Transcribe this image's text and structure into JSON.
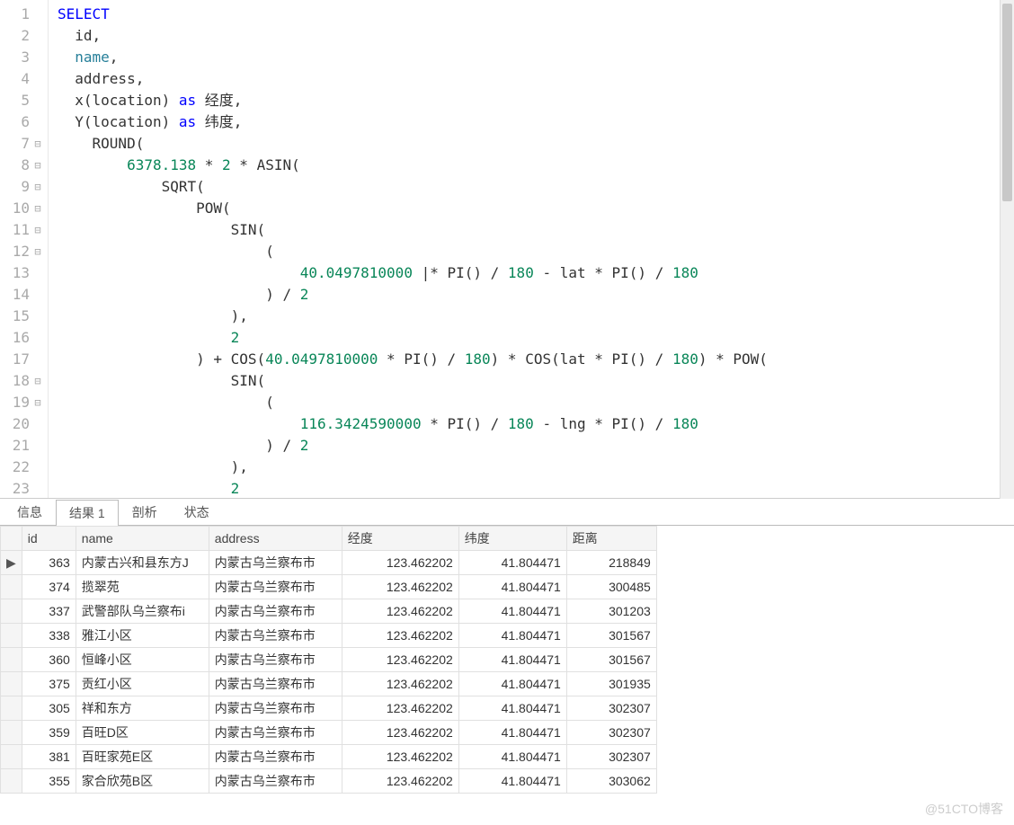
{
  "editor": {
    "lines": [
      {
        "n": 1,
        "fold": "",
        "tokens": [
          [
            "k",
            "SELECT"
          ]
        ]
      },
      {
        "n": 2,
        "fold": "",
        "tokens": [
          [
            "op",
            "  id,"
          ]
        ]
      },
      {
        "n": 3,
        "fold": "",
        "tokens": [
          [
            "op",
            "  "
          ],
          [
            "id",
            "name"
          ],
          [
            "op",
            ","
          ]
        ]
      },
      {
        "n": 4,
        "fold": "",
        "tokens": [
          [
            "op",
            "  address,"
          ]
        ]
      },
      {
        "n": 5,
        "fold": "",
        "tokens": [
          [
            "op",
            "  x(location) "
          ],
          [
            "k",
            "as"
          ],
          [
            "op",
            " 经度,"
          ]
        ]
      },
      {
        "n": 6,
        "fold": "",
        "tokens": [
          [
            "op",
            "  Y(location) "
          ],
          [
            "k",
            "as"
          ],
          [
            "op",
            " 纬度,"
          ]
        ]
      },
      {
        "n": 7,
        "fold": "⊟",
        "tokens": [
          [
            "op",
            "    ROUND("
          ]
        ]
      },
      {
        "n": 8,
        "fold": "⊟",
        "tokens": [
          [
            "op",
            "        "
          ],
          [
            "num",
            "6378.138"
          ],
          [
            "op",
            " * "
          ],
          [
            "num",
            "2"
          ],
          [
            "op",
            " * ASIN("
          ]
        ]
      },
      {
        "n": 9,
        "fold": "⊟",
        "tokens": [
          [
            "op",
            "            SQRT("
          ]
        ]
      },
      {
        "n": 10,
        "fold": "⊟",
        "tokens": [
          [
            "op",
            "                POW("
          ]
        ]
      },
      {
        "n": 11,
        "fold": "⊟",
        "tokens": [
          [
            "op",
            "                    SIN("
          ]
        ]
      },
      {
        "n": 12,
        "fold": "⊟",
        "tokens": [
          [
            "op",
            "                        ("
          ]
        ]
      },
      {
        "n": 13,
        "fold": "",
        "tokens": [
          [
            "op",
            "                            "
          ],
          [
            "num",
            "40.0497810000"
          ],
          [
            "op",
            " |* PI() / "
          ],
          [
            "num",
            "180"
          ],
          [
            "op",
            " - lat * PI() / "
          ],
          [
            "num",
            "180"
          ]
        ]
      },
      {
        "n": 14,
        "fold": "",
        "tokens": [
          [
            "op",
            "                        ) / "
          ],
          [
            "num",
            "2"
          ]
        ]
      },
      {
        "n": 15,
        "fold": "",
        "tokens": [
          [
            "op",
            "                    ),"
          ]
        ]
      },
      {
        "n": 16,
        "fold": "",
        "tokens": [
          [
            "op",
            "                    "
          ],
          [
            "num",
            "2"
          ]
        ]
      },
      {
        "n": 17,
        "fold": "",
        "tokens": [
          [
            "op",
            "                ) + COS("
          ],
          [
            "num",
            "40.0497810000"
          ],
          [
            "op",
            " * PI() / "
          ],
          [
            "num",
            "180"
          ],
          [
            "op",
            ") * COS(lat * PI() / "
          ],
          [
            "num",
            "180"
          ],
          [
            "op",
            ") * POW("
          ]
        ]
      },
      {
        "n": 18,
        "fold": "⊟",
        "tokens": [
          [
            "op",
            "                    SIN("
          ]
        ]
      },
      {
        "n": 19,
        "fold": "⊟",
        "tokens": [
          [
            "op",
            "                        ("
          ]
        ]
      },
      {
        "n": 20,
        "fold": "",
        "tokens": [
          [
            "op",
            "                            "
          ],
          [
            "num",
            "116.3424590000"
          ],
          [
            "op",
            " * PI() / "
          ],
          [
            "num",
            "180"
          ],
          [
            "op",
            " - lng * PI() / "
          ],
          [
            "num",
            "180"
          ]
        ]
      },
      {
        "n": 21,
        "fold": "",
        "tokens": [
          [
            "op",
            "                        ) / "
          ],
          [
            "num",
            "2"
          ]
        ]
      },
      {
        "n": 22,
        "fold": "",
        "tokens": [
          [
            "op",
            "                    ),"
          ]
        ]
      },
      {
        "n": 23,
        "fold": "",
        "tokens": [
          [
            "op",
            "                    "
          ],
          [
            "num",
            "2"
          ]
        ]
      }
    ]
  },
  "tabs": {
    "items": [
      {
        "label": "信息",
        "active": false
      },
      {
        "label": "结果 1",
        "active": true
      },
      {
        "label": "剖析",
        "active": false
      },
      {
        "label": "状态",
        "active": false
      }
    ]
  },
  "results": {
    "columns": [
      "id",
      "name",
      "address",
      "经度",
      "纬度",
      "距离"
    ],
    "rows": [
      {
        "mark": "▶",
        "id": 363,
        "name": "内蒙古兴和县东方J",
        "address": "内蒙古乌兰察布市",
        "lng": "123.462202",
        "lat": "41.804471",
        "dist": "218849"
      },
      {
        "mark": "",
        "id": 374,
        "name": "揽翠苑",
        "address": "内蒙古乌兰察布市",
        "lng": "123.462202",
        "lat": "41.804471",
        "dist": "300485"
      },
      {
        "mark": "",
        "id": 337,
        "name": "武警部队乌兰察布i",
        "address": "内蒙古乌兰察布市",
        "lng": "123.462202",
        "lat": "41.804471",
        "dist": "301203"
      },
      {
        "mark": "",
        "id": 338,
        "name": "雅江小区",
        "address": "内蒙古乌兰察布市",
        "lng": "123.462202",
        "lat": "41.804471",
        "dist": "301567"
      },
      {
        "mark": "",
        "id": 360,
        "name": "恒峰小区",
        "address": "内蒙古乌兰察布市",
        "lng": "123.462202",
        "lat": "41.804471",
        "dist": "301567"
      },
      {
        "mark": "",
        "id": 375,
        "name": "贡红小区",
        "address": "内蒙古乌兰察布市",
        "lng": "123.462202",
        "lat": "41.804471",
        "dist": "301935"
      },
      {
        "mark": "",
        "id": 305,
        "name": "祥和东方",
        "address": "内蒙古乌兰察布市",
        "lng": "123.462202",
        "lat": "41.804471",
        "dist": "302307"
      },
      {
        "mark": "",
        "id": 359,
        "name": "百旺D区",
        "address": "内蒙古乌兰察布市",
        "lng": "123.462202",
        "lat": "41.804471",
        "dist": "302307"
      },
      {
        "mark": "",
        "id": 381,
        "name": "百旺家苑E区",
        "address": "内蒙古乌兰察布市",
        "lng": "123.462202",
        "lat": "41.804471",
        "dist": "302307"
      },
      {
        "mark": "",
        "id": 355,
        "name": "家合欣苑B区",
        "address": "内蒙古乌兰察布市",
        "lng": "123.462202",
        "lat": "41.804471",
        "dist": "303062"
      }
    ]
  },
  "watermark": "@51CTO博客"
}
